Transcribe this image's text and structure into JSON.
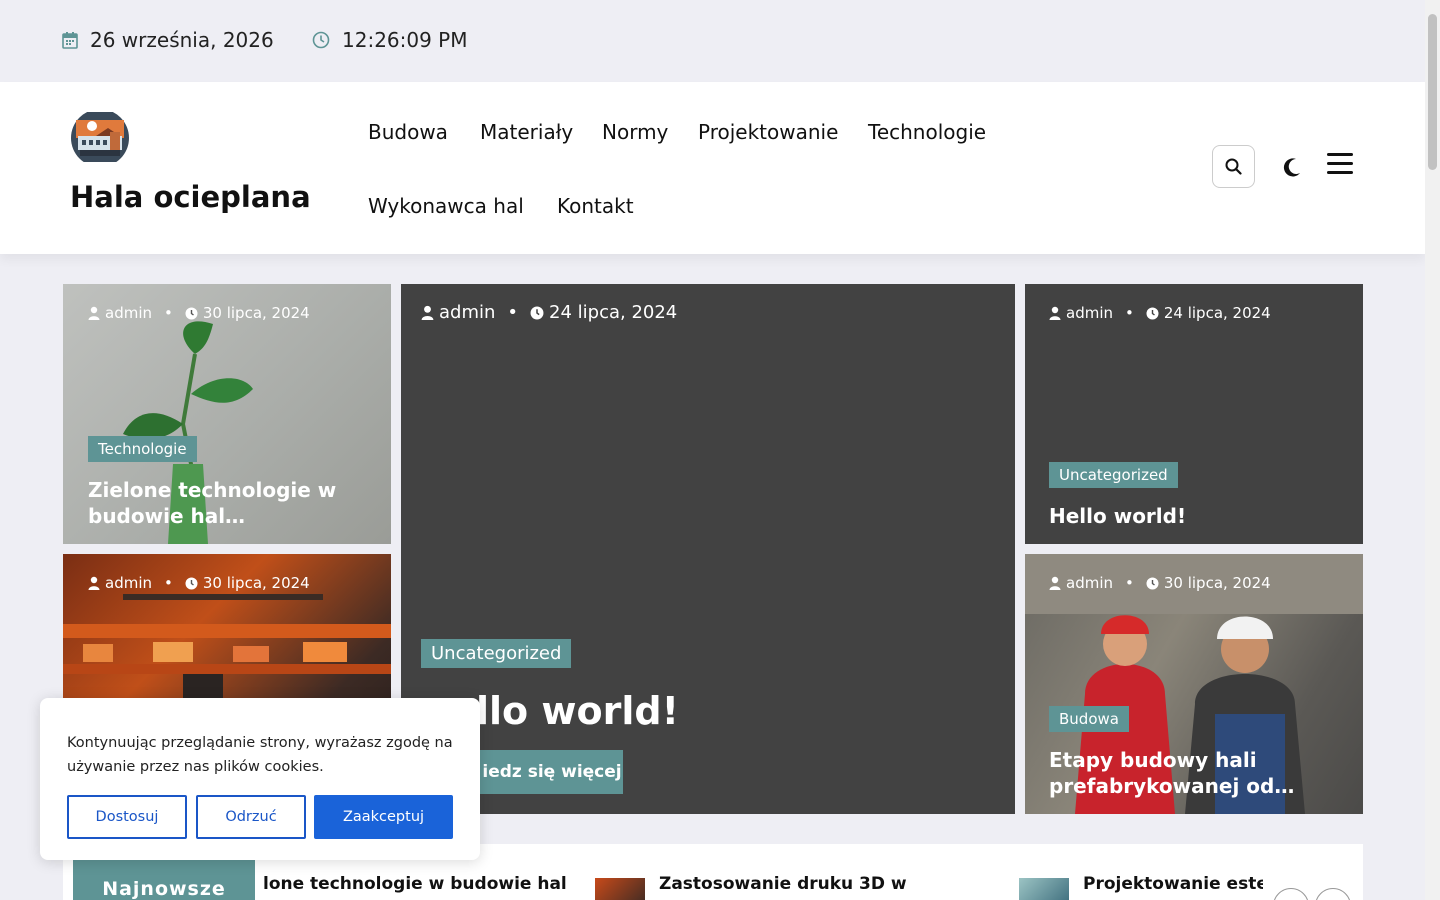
{
  "topbar": {
    "date": "26 września, 2026",
    "time": "12:26:09 PM"
  },
  "header": {
    "site_title": "Hala ocieplana",
    "nav": [
      "Budowa",
      "Materiały",
      "Normy",
      "Projektowanie",
      "Technologie",
      "Wykonawca hal",
      "Kontakt"
    ]
  },
  "cards": [
    {
      "author": "admin",
      "date": "30 lipca, 2024",
      "category": "Technologie",
      "title_line1": "Zielone technologie w",
      "title_line2": "budowie hal…"
    },
    {
      "author": "admin",
      "date": "24 lipca, 2024",
      "category": "Uncategorized",
      "title": "llo world!",
      "read_more": "iedz się więcej"
    },
    {
      "author": "admin",
      "date": "24 lipca, 2024",
      "category": "Uncategorized",
      "title": "Hello world!"
    },
    {
      "author": "admin",
      "date": "30 lipca, 2024"
    },
    {
      "author": "admin",
      "date": "30 lipca, 2024",
      "category": "Budowa",
      "title_line1": "Etapy budowy hali",
      "title_line2": "prefabrykowanej od…"
    }
  ],
  "latest": {
    "label": "Najnowsze",
    "items": [
      "lone technologie w budowie hal",
      "Zastosowanie druku 3D w",
      "Projektowanie estet"
    ]
  },
  "cookie": {
    "text": "Kontynuując przeglądanie strony, wyrażasz zgodę na używanie przez nas plików cookies.",
    "customize": "Dostosuj",
    "reject": "Odrzuć",
    "accept": "Zaakceptuj"
  },
  "colors": {
    "accent": "#5e9495",
    "primary_button": "#1a63d9",
    "card_dark": "#424242"
  }
}
